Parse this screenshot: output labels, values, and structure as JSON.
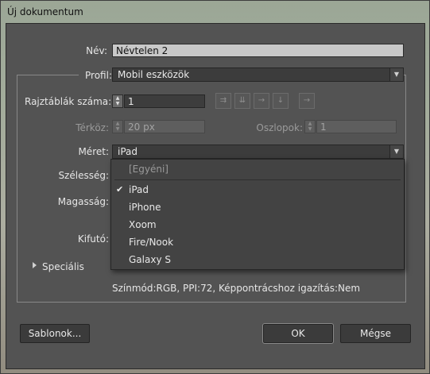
{
  "window": {
    "title": "Új dokumentum"
  },
  "form": {
    "name_label": "Név:",
    "name_value": "Névtelen 2",
    "profile_label": "Profil:",
    "profile_value": "Mobil eszközök",
    "artboards_label": "Rajztáblák száma:",
    "artboards_value": "1",
    "spacing_label": "Térköz:",
    "spacing_value": "20 px",
    "columns_label": "Oszlopok:",
    "columns_value": "1",
    "size_label": "Méret:",
    "size_value": "iPad",
    "width_label": "Szélesség:",
    "height_label": "Magasság:",
    "bleed_label": "Kifutó:",
    "advanced_label": "Speciális",
    "info_text": "Színmód:RGB, PPI:72, Képpontrácshoz igazítás:Nem"
  },
  "size_options": [
    {
      "label": "[Egyéni]",
      "disabled": true
    },
    {
      "label": "iPad",
      "checked": true
    },
    {
      "label": "iPhone"
    },
    {
      "label": "Xoom"
    },
    {
      "label": "Fire/Nook"
    },
    {
      "label": "Galaxy S"
    }
  ],
  "buttons": {
    "templates": "Sablonok...",
    "ok": "OK",
    "cancel": "Mégse"
  },
  "icons": {
    "spin_up": "▲",
    "spin_down": "▼",
    "dropdown_arrow": "▼",
    "checkmark": "✔"
  }
}
